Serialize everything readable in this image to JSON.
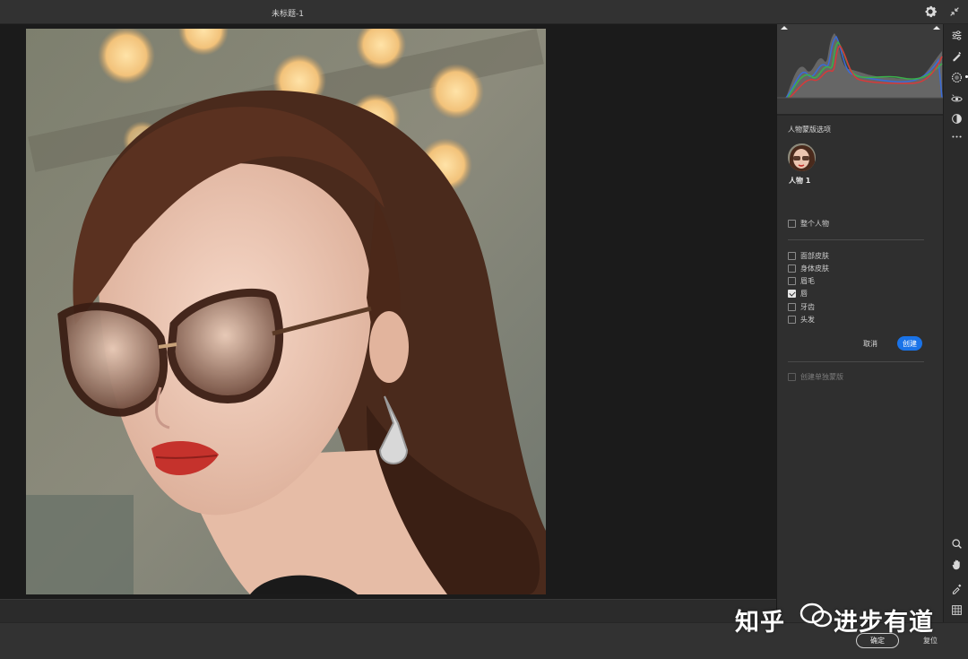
{
  "window": {
    "title": "未标题-1"
  },
  "panel": {
    "section_title": "人物蒙版选项",
    "person_label": "人物  1",
    "whole_person": {
      "label": "整个人物",
      "checked": false
    },
    "parts": [
      {
        "label": "面部皮肤",
        "checked": false
      },
      {
        "label": "身体皮肤",
        "checked": false
      },
      {
        "label": "眉毛",
        "checked": false
      },
      {
        "label": "唇",
        "checked": true
      },
      {
        "label": "牙齿",
        "checked": false
      },
      {
        "label": "头发",
        "checked": false
      }
    ],
    "cancel_label": "取消",
    "create_label": "创建",
    "separate_masks": {
      "label": "创建单独蒙版",
      "checked": false
    }
  },
  "footer": {
    "ok_label": "确定",
    "reset_label": "复位"
  },
  "watermark": {
    "left": "知乎",
    "right": "进步有道"
  },
  "icons": [
    "settings-gear-icon",
    "collapse-arrows-icon",
    "sliders-icon",
    "healing-brush-icon",
    "mask-icon",
    "red-eye-icon",
    "presets-icon",
    "more-icon",
    "zoom-icon",
    "hand-icon",
    "color-sampler-icon",
    "grid-icon"
  ],
  "colors": {
    "accent": "#1a73e8",
    "panel": "#2f2f2f",
    "canvas": "#1b1b1b"
  }
}
